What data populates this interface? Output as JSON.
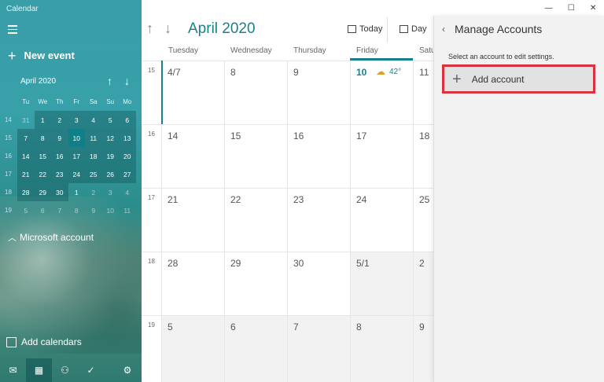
{
  "app": {
    "title": "Calendar"
  },
  "sidebar": {
    "new_event": "New event",
    "mini_calendar": {
      "month_label": "April 2020",
      "days_of_week": [
        "Tu",
        "We",
        "Th",
        "Fr",
        "Sa",
        "Su",
        "Mo"
      ],
      "weeks": [
        {
          "week": "14",
          "days": [
            "31",
            "1",
            "2",
            "3",
            "4",
            "5",
            "6"
          ]
        },
        {
          "week": "15",
          "days": [
            "7",
            "8",
            "9",
            "10",
            "11",
            "12",
            "13"
          ]
        },
        {
          "week": "16",
          "days": [
            "14",
            "15",
            "16",
            "17",
            "18",
            "19",
            "20"
          ]
        },
        {
          "week": "17",
          "days": [
            "21",
            "22",
            "23",
            "24",
            "25",
            "26",
            "27"
          ]
        },
        {
          "week": "18",
          "days": [
            "28",
            "29",
            "30",
            "1",
            "2",
            "3",
            "4"
          ]
        },
        {
          "week": "19",
          "days": [
            "5",
            "6",
            "7",
            "8",
            "9",
            "10",
            "11"
          ]
        }
      ]
    },
    "account_section": "Microsoft account",
    "add_calendars": "Add calendars"
  },
  "toolbar": {
    "title": "April 2020",
    "today_label": "Today",
    "day_label": "Day"
  },
  "calendar": {
    "days_of_week": [
      "Tuesday",
      "Wednesday",
      "Thursday",
      "Friday",
      "Satu"
    ],
    "weeks": [
      {
        "week": "15",
        "days": [
          "4/7",
          "8",
          "9",
          "10",
          "11"
        ]
      },
      {
        "week": "16",
        "days": [
          "14",
          "15",
          "16",
          "17",
          "18"
        ]
      },
      {
        "week": "17",
        "days": [
          "21",
          "22",
          "23",
          "24",
          "25"
        ]
      },
      {
        "week": "18",
        "days": [
          "28",
          "29",
          "30",
          "5/1",
          "2"
        ]
      },
      {
        "week": "19",
        "days": [
          "5",
          "6",
          "7",
          "8",
          "9"
        ]
      }
    ],
    "weather_temp": "42°"
  },
  "panel": {
    "title": "Manage Accounts",
    "hint": "Select an account to edit settings.",
    "add_account": "Add account"
  },
  "colors": {
    "accent": "#1a7f8c",
    "highlight_border": "#d9333f"
  }
}
